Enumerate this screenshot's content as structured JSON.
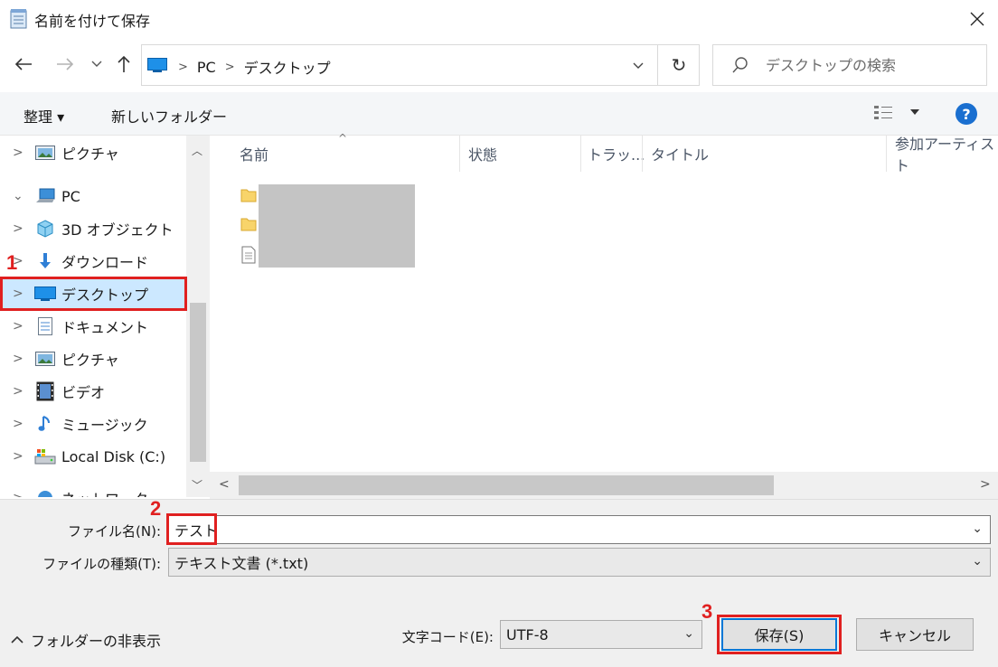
{
  "window": {
    "title": "名前を付けて保存"
  },
  "address": {
    "crumbs": [
      "PC",
      "デスクトップ"
    ],
    "search_placeholder": "デスクトップの検索"
  },
  "toolbar": {
    "organize_label": "整理 ▾",
    "new_folder_label": "新しいフォルダー",
    "help_label": "?"
  },
  "navpane": {
    "items": [
      {
        "label": "ピクチャ",
        "icon": "pictures-icon"
      },
      {
        "label": "PC",
        "icon": "pc-icon"
      },
      {
        "label": "3D オブジェクト",
        "icon": "3d-objects-icon"
      },
      {
        "label": "ダウンロード",
        "icon": "download-icon"
      },
      {
        "label": "デスクトップ",
        "icon": "desktop-icon"
      },
      {
        "label": "ドキュメント",
        "icon": "documents-icon"
      },
      {
        "label": "ピクチャ",
        "icon": "pictures-icon"
      },
      {
        "label": "ビデオ",
        "icon": "video-icon"
      },
      {
        "label": "ミュージック",
        "icon": "music-icon"
      },
      {
        "label": "Local Disk (C:)",
        "icon": "local-disk-icon"
      },
      {
        "label": "ネットワーク",
        "icon": "network-icon"
      }
    ]
  },
  "filelist": {
    "columns": [
      "名前",
      "状態",
      "トラッ...",
      "タイトル",
      "参加アーティスト"
    ]
  },
  "form": {
    "filename_label": "ファイル名(N):",
    "filename_value": "テスト",
    "filetype_label": "ファイルの種類(T):",
    "filetype_value": "テキスト文書 (*.txt)",
    "encoding_label": "文字コード(E):",
    "encoding_value": "UTF-8",
    "hide_folders_label": "フォルダーの非表示",
    "save_label": "保存(S)",
    "cancel_label": "キャンセル"
  },
  "annotations": {
    "step1": "1",
    "step2": "2",
    "step3": "3"
  },
  "colors": {
    "highlight": "#e02020",
    "selection": "#cce8ff",
    "accent": "#0078d7"
  }
}
